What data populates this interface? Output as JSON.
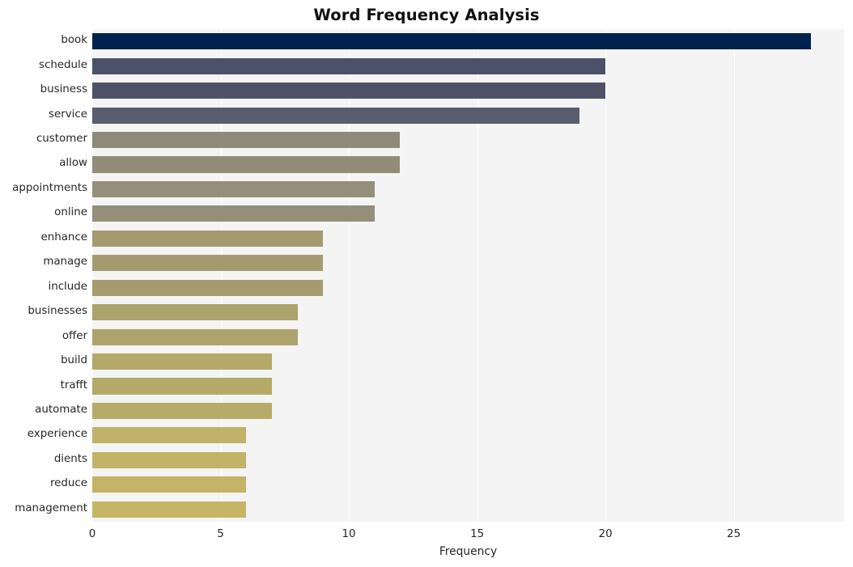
{
  "chart_data": {
    "type": "bar",
    "orientation": "horizontal",
    "title": "Word Frequency Analysis",
    "xlabel": "Frequency",
    "ylabel": "",
    "xlim": [
      0,
      29.3
    ],
    "xticks": [
      0,
      5,
      10,
      15,
      20,
      25
    ],
    "xticklabels": [
      "0",
      "5",
      "10",
      "15",
      "20",
      "25"
    ],
    "grid": "vertical-only",
    "legend": "none",
    "categories": [
      "book",
      "schedule",
      "business",
      "service",
      "customer",
      "allow",
      "appointments",
      "online",
      "enhance",
      "manage",
      "include",
      "businesses",
      "offer",
      "build",
      "trafft",
      "automate",
      "experience",
      "dients",
      "reduce",
      "management"
    ],
    "values": [
      28,
      20,
      20,
      19,
      12,
      12,
      11,
      11,
      9,
      9,
      9,
      8,
      8,
      7,
      7,
      7,
      6,
      6,
      6,
      6
    ],
    "bar_colors": [
      "#00224f",
      "#4b5168",
      "#4d5269",
      "#585d70",
      "#8d8a79",
      "#918d79",
      "#948f78",
      "#948f78",
      "#a39b6f",
      "#a49c6f",
      "#a59d6e",
      "#aca26c",
      "#ada36c",
      "#b5a96a",
      "#b6aa6a",
      "#b7ab69",
      "#c0b268",
      "#c1b368",
      "#c3b467",
      "#c5b667"
    ],
    "plot_background": "#f4f4f5",
    "grid_color": "#ffffff",
    "figure_background": "#ffffff",
    "text_color": "#262626"
  }
}
